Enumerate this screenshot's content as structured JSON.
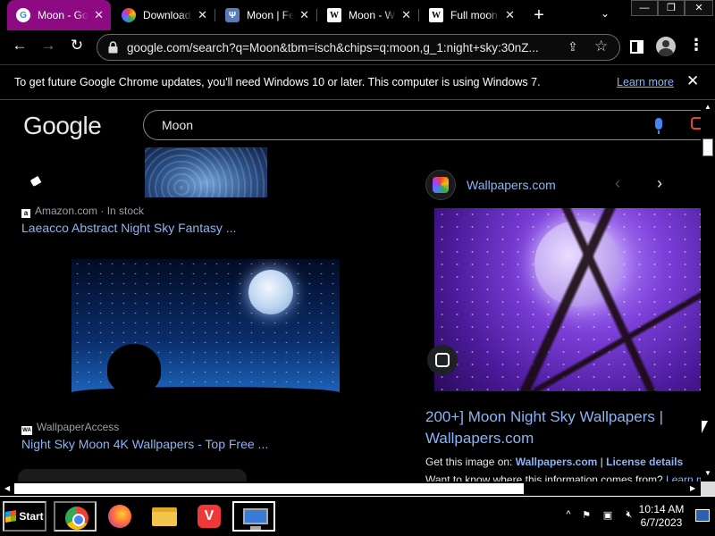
{
  "browser": {
    "tabs": [
      {
        "title": "Moon - Google",
        "favicon": "google-g",
        "active": true
      },
      {
        "title": "Download",
        "favicon": "pinwheel"
      },
      {
        "title": "Moon | Feral",
        "favicon": "site-emblem"
      },
      {
        "title": "Moon - Wikipedia",
        "favicon": "wikipedia-w"
      },
      {
        "title": "Full moon - Wikipedia",
        "favicon": "wikipedia-w"
      }
    ],
    "tab_close_glyph": "✕",
    "new_tab_glyph": "+",
    "tab_search_glyph": "⌄",
    "window_controls": {
      "minimize": "—",
      "restore": "❐",
      "close": "✕"
    },
    "url": "google.com/search?q=Moon&tbm=isch&chips=q:moon,g_1:night+sky:30nZ...",
    "accent_color": "#8e0a83"
  },
  "infobar": {
    "message": "To get future Google Chrome updates, you'll need Windows 10 or later. This computer is using Windows 7.",
    "link": "Learn more",
    "close": "✕"
  },
  "google": {
    "logo": "Google",
    "query": "Moon"
  },
  "results": {
    "left": [
      {
        "source": "Amazon.com · In stock",
        "source_icon": "a",
        "title": "Laeacco Abstract Night Sky Fantasy ..."
      },
      {
        "source": "WallpaperAccess",
        "source_icon": "WA",
        "title": "Night Sky Moon 4K Wallpapers - Top Free ..."
      }
    ]
  },
  "preview": {
    "source_name": "Wallpapers.com",
    "nav_prev": "‹",
    "nav_next": "›",
    "title": "200+] Moon Night Sky Wallpapers | Wallpapers.com",
    "get_image_label": "Get this image on:",
    "get_image_site": "Wallpapers.com",
    "separator": "|",
    "license": "License details",
    "want_text": "Want to know where this information comes from?",
    "want_link": "Learn m"
  },
  "scroll": {
    "up": "▲",
    "down": "▼",
    "left": "◀",
    "right": "▶"
  },
  "taskbar": {
    "start_label": "Start",
    "clock_time": "10:14 AM",
    "clock_date": "6/7/2023",
    "tray_expand": "^"
  }
}
